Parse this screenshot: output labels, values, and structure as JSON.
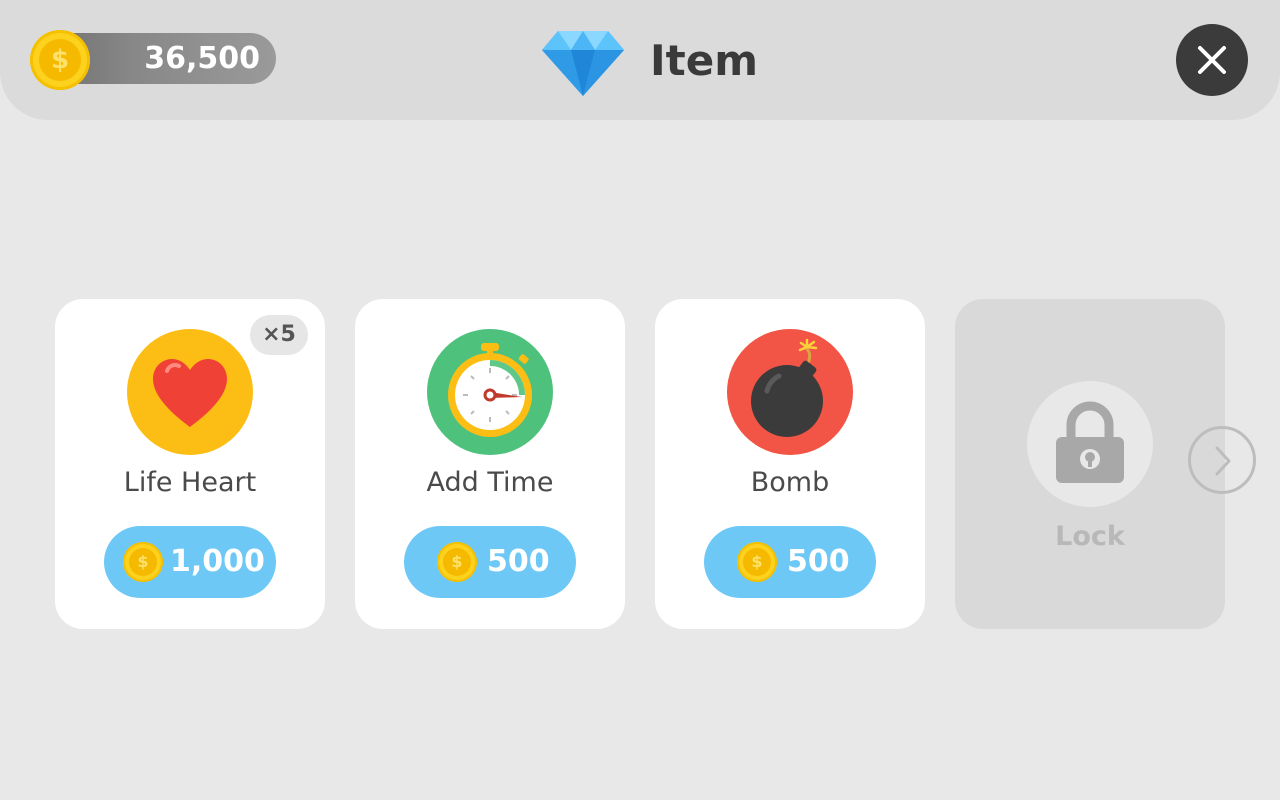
{
  "header": {
    "balance": "36,500",
    "coin_symbol": "$",
    "title": "Item",
    "title_icon": "diamond-icon",
    "close_icon": "close-icon"
  },
  "items": [
    {
      "name": "Life Heart",
      "price": "1,000",
      "badge": "×5",
      "icon": "heart-icon",
      "circle_color": "#fcbe14"
    },
    {
      "name": "Add Time",
      "price": "500",
      "icon": "stopwatch-icon",
      "circle_color": "#4ec27c"
    },
    {
      "name": "Bomb",
      "price": "500",
      "icon": "bomb-icon",
      "circle_color": "#f25545"
    }
  ],
  "locked_slot": {
    "label": "Lock",
    "icon": "lock-icon"
  },
  "navigation": {
    "next_icon": "chevron-right-icon"
  },
  "colors": {
    "background": "#e8e8e8",
    "topbar": "#dcdbdc",
    "price_button": "#6ec8f6",
    "close_button": "#3b3b3b",
    "coin": "#fdd21f"
  }
}
